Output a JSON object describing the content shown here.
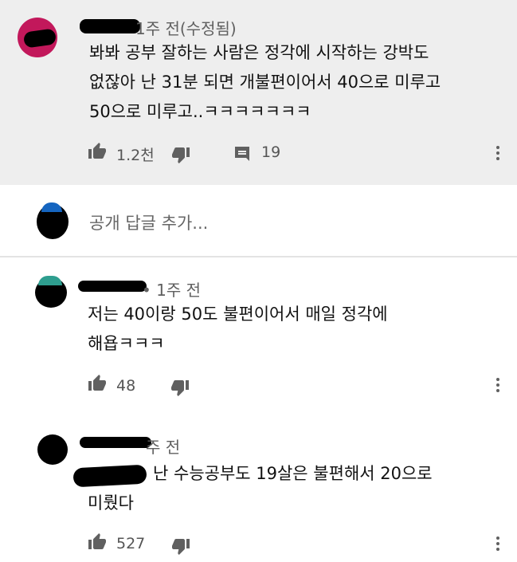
{
  "main_comment": {
    "meta": "1주 전(수정됨)",
    "lines": [
      "봐봐 공부 잘하는 사람은 정각에 시작하는 강박도",
      "없잖아 난 31분 되면 개불편이어서 40으로 미루고",
      "50으로 미루고..ㅋㅋㅋㅋㅋㅋㅋ"
    ],
    "likes": "1.2천",
    "replies_count": "19"
  },
  "reply_input": {
    "placeholder": "공개 답글 추가..."
  },
  "replies": [
    {
      "meta": "• 1주 전",
      "lines": [
        "저는 40이랑 50도 불편이어서 매일 정각에",
        "해욥ㅋㅋㅋ"
      ],
      "likes": "48"
    },
    {
      "meta": "주 전",
      "lines": [
        "난 수능공부도 19살은 불편해서 20으로",
        "미뤘다"
      ],
      "likes": "527"
    }
  ],
  "colors": {
    "main_bg": "#eeeeee",
    "avatar_main": "#c2185b",
    "avatar_input": "#1565c0",
    "avatar_reply1": "#2e9e8f",
    "avatar_reply2": "#000000"
  },
  "icons": [
    "thumb-up-icon",
    "thumb-down-icon",
    "comment-icon",
    "more-vert-icon"
  ]
}
